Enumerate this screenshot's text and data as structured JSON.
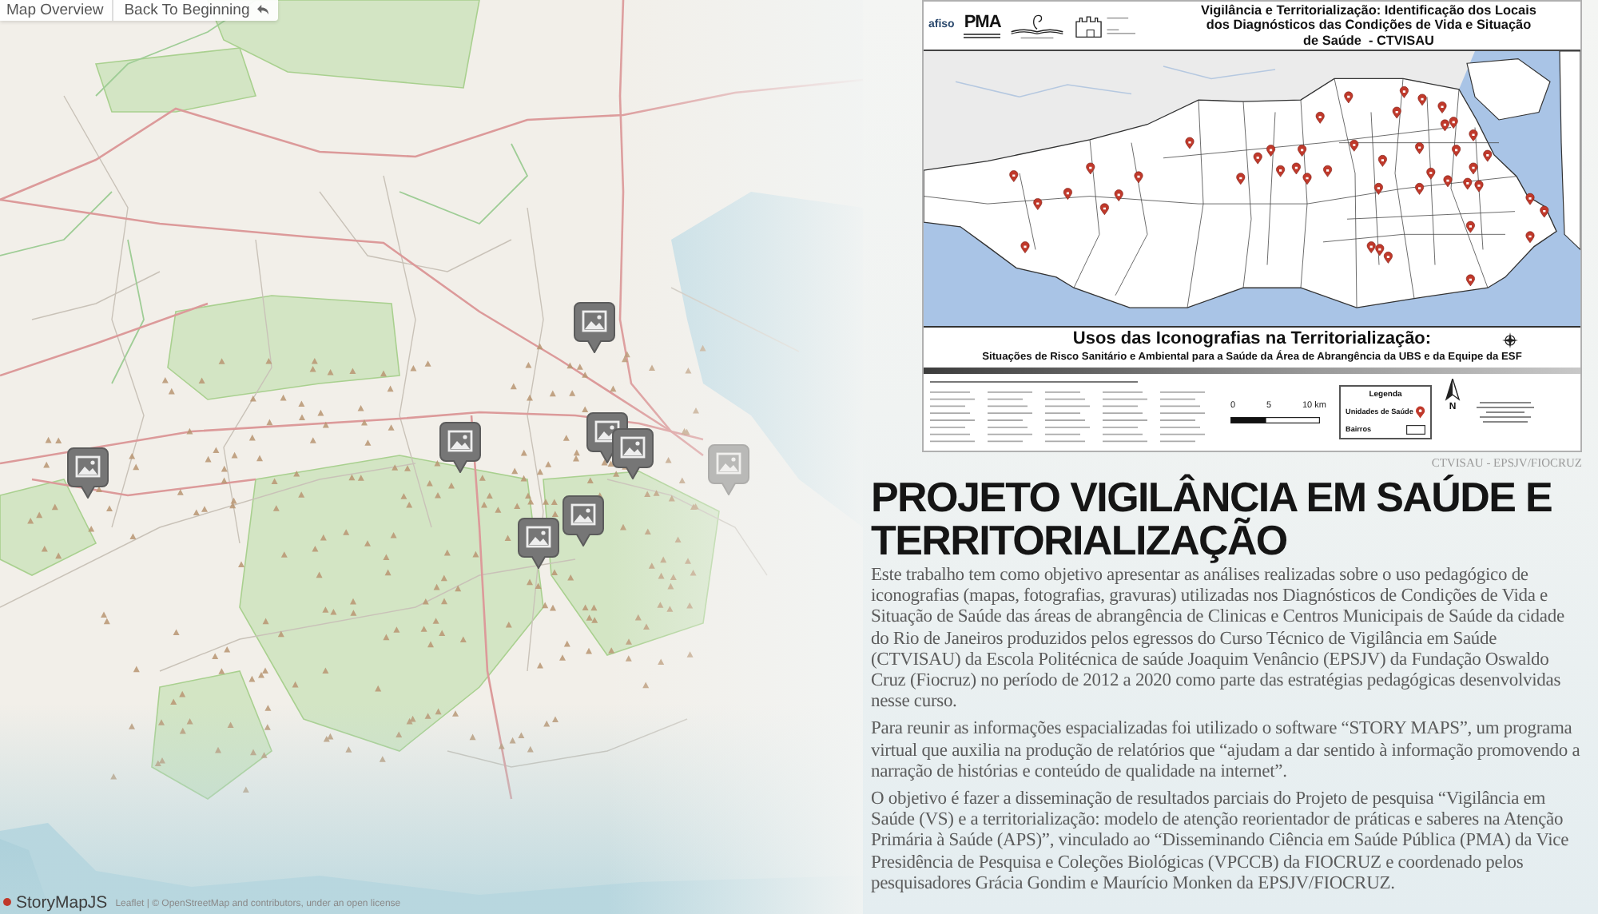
{
  "toolbar": {
    "buttons": [
      {
        "label": "Map Overview",
        "kind": "overview"
      },
      {
        "label": "Back To Beginning",
        "kind": "back"
      }
    ]
  },
  "slide": {
    "poster": {
      "logos": [
        {
          "kind": "wordmark",
          "text": "afiso"
        },
        {
          "kind": "block",
          "text": "PMA"
        },
        {
          "kind": "book"
        },
        {
          "kind": "castle"
        }
      ],
      "title_lines": [
        "Vigilância e Territorialização: Identificação dos Locais",
        "dos Diagnósticos das Condições de Vida e Situação",
        "de Saúde  - CTVISAU"
      ],
      "banner_title": "Usos das Iconografias na Territorialização:",
      "banner_subtitle": "Situações de Risco Sanitário e Ambiental para a Saúde da Área de Abrangência da UBS e da Equipe da ESF",
      "scale_labels": [
        "0",
        "5",
        "10 km"
      ],
      "legend": {
        "title": "Legenda",
        "items": [
          {
            "label": "Unidades de Saúde",
            "kind": "pin"
          },
          {
            "label": "Bairros",
            "kind": "area"
          }
        ]
      },
      "north_label": "N"
    },
    "caption": "CTVISAU - EPSJV/FIOCRUZ",
    "headline": "PROJETO VIGILÂNCIA EM SAÚDE E TERRITORIALIZAÇÃO",
    "paragraphs": [
      "Este trabalho tem como objetivo apresentar as análises realizadas sobre o uso pedagógico de iconografias (mapas, fotografias, gravuras) utilizadas nos Diagnósticos de Condições de Vida e Situação de Saúde das áreas de abrangência de Clinicas e Centros Municipais de Saúde da cidade do Rio de Janeiros produzidos pelos egressos do Curso Técnico de Vigilância em Saúde (CTVISAU) da Escola Politécnica de saúde Joaquim Venâncio (EPSJV) da Fundação Oswaldo Cruz (Fiocruz) no período de 2012 a 2020 como parte das estratégias pedagógicas desenvolvidas nesse curso.",
      "Para reunir as informações espacializadas foi utilizado o software “STORY MAPS”, um programa virtual que auxilia na produção de relatórios que “ajudam a dar sentido à informação promovendo a narração de histórias e conteúdo de qualidade na internet”.",
      "O objetivo é fazer a disseminação de resultados parciais do Projeto de pesquisa “Vigilância em Saúde (VS) e a territorialização: modelo de atenção reorientador de práticas e saberes na Atenção Primária à Saúde (APS)”, vinculado ao “Disseminando Ciência em Saúde Pública (PMA) da Vice Presidência de Pesquisa e Coleções Biológicas (VPCCB) da FIOCRUZ e coordenado pelos pesquisadores Grácia Gondim e Maurício Monken da EPSJV/FIOCRUZ."
    ]
  },
  "footer": {
    "brand": "StoryMapJS",
    "attribution": "Leaflet | © OpenStreetMap and contributors, under an open license"
  }
}
